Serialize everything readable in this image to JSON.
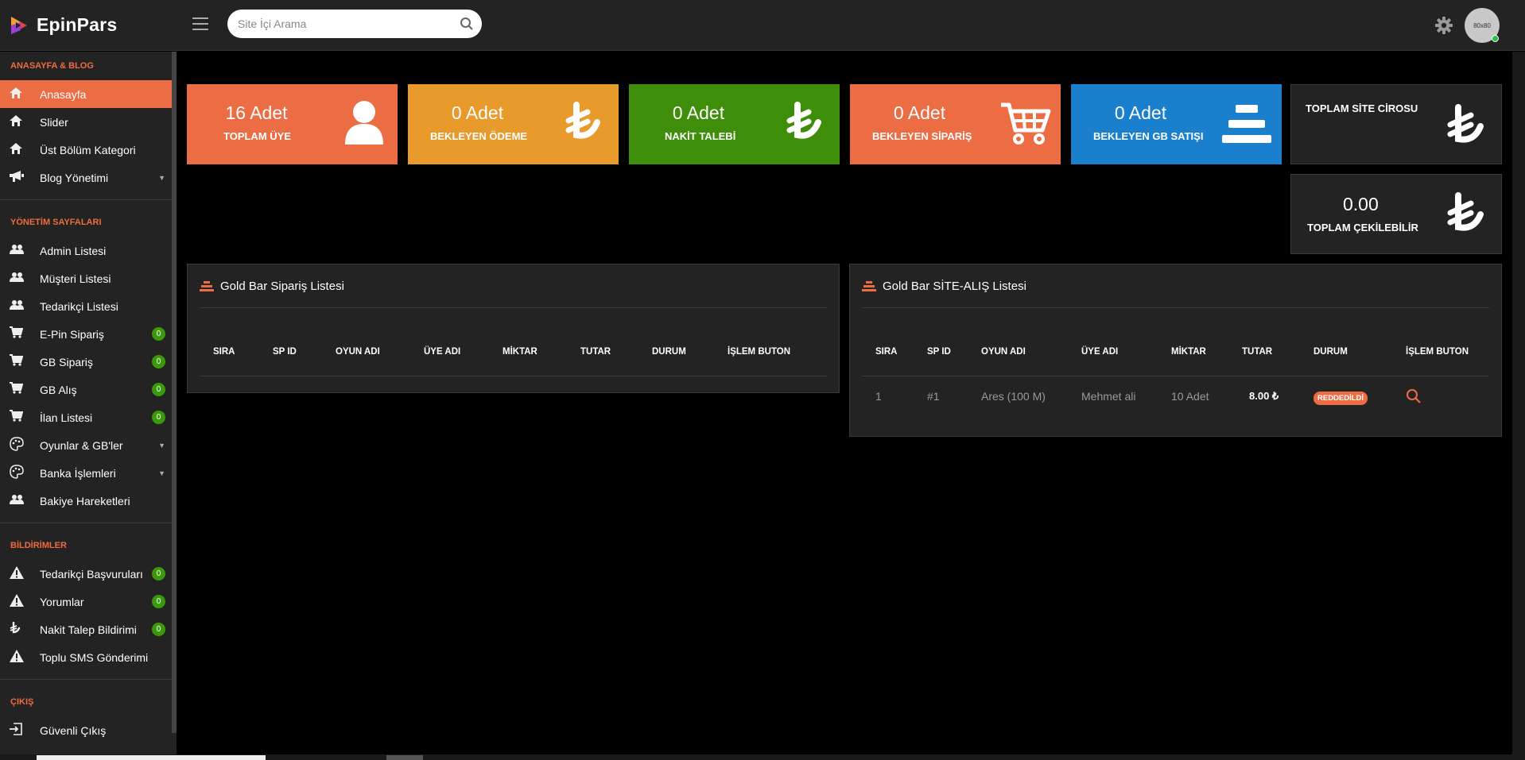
{
  "app": {
    "name": "EpinPars"
  },
  "search": {
    "placeholder": "Site İçi Arama"
  },
  "avatar": {
    "text": "80x80"
  },
  "sidebar": {
    "sections": [
      {
        "title": "ANASAYFA & BLOG",
        "items": [
          {
            "label": "Anasayfa",
            "icon": "home-icon",
            "active": true
          },
          {
            "label": "Slider",
            "icon": "home-icon"
          },
          {
            "label": "Üst Bölüm Kategori",
            "icon": "home-icon"
          },
          {
            "label": "Blog Yönetimi",
            "icon": "megaphone-icon",
            "caret": true
          }
        ]
      },
      {
        "title": "YÖNETİM SAYFALARI",
        "items": [
          {
            "label": "Admin Listesi",
            "icon": "users-icon"
          },
          {
            "label": "Müşteri Listesi",
            "icon": "users-icon"
          },
          {
            "label": "Tedarikçi Listesi",
            "icon": "users-icon"
          },
          {
            "label": "E-Pin Sipariş",
            "icon": "cart-icon",
            "badge": "0"
          },
          {
            "label": "GB Sipariş",
            "icon": "cart-icon",
            "badge": "0"
          },
          {
            "label": "GB Alış",
            "icon": "cart-icon",
            "badge": "0"
          },
          {
            "label": "İlan Listesi",
            "icon": "cart-icon",
            "badge": "0"
          },
          {
            "label": "Oyunlar & GB'ler",
            "icon": "palette-icon",
            "caret": true
          },
          {
            "label": "Banka İşlemleri",
            "icon": "palette-icon",
            "caret": true
          },
          {
            "label": "Bakiye Hareketleri",
            "icon": "users-icon"
          }
        ]
      },
      {
        "title": "BİLDİRİMLER",
        "items": [
          {
            "label": "Tedarikçi Başvuruları",
            "icon": "warning-icon",
            "badge": "0"
          },
          {
            "label": "Yorumlar",
            "icon": "warning-icon",
            "badge": "0"
          },
          {
            "label": "Nakit Talep Bildirimi",
            "icon": "lira-icon",
            "badge": "0"
          },
          {
            "label": "Toplu SMS Gönderimi",
            "icon": "warning-icon"
          }
        ]
      },
      {
        "title": "ÇIKIŞ",
        "items": [
          {
            "label": "Güvenli Çıkış",
            "icon": "logout-icon"
          }
        ]
      }
    ]
  },
  "cards": [
    {
      "number": "16 Adet",
      "label": "TOPLAM ÜYE",
      "color": "#ec6c44",
      "icon": "user-icon"
    },
    {
      "number": "0 Adet",
      "label": "BEKLEYEN ÖDEME",
      "color": "#e89a2b",
      "icon": "lira-icon"
    },
    {
      "number": "0 Adet",
      "label": "NAKİT TALEBİ",
      "color": "#3f8e0a",
      "icon": "lira-icon"
    },
    {
      "number": "0 Adet",
      "label": "BEKLEYEN SİPARİŞ",
      "color": "#ec6c44",
      "icon": "cart-icon"
    },
    {
      "number": "0 Adet",
      "label": "BEKLEYEN GB SATIŞI",
      "color": "#1a7fcd",
      "icon": "gold-bars-icon"
    }
  ],
  "dark_cards": [
    {
      "label": "TOPLAM SİTE CİROSU",
      "icon": "lira-icon"
    },
    {
      "number": "0.00",
      "label": "TOPLAM ÇEKİLEBİLİR",
      "icon": "lira-icon"
    }
  ],
  "panel_left": {
    "title": "Gold Bar Sipariş Listesi",
    "columns": [
      "SIRA",
      "SP ID",
      "OYUN ADI",
      "ÜYE ADI",
      "MİKTAR",
      "TUTAR",
      "DURUM",
      "İŞLEM BUTON"
    ]
  },
  "panel_right": {
    "title": "Gold Bar SİTE-ALIŞ Listesi",
    "columns": [
      "SIRA",
      "SP ID",
      "OYUN ADI",
      "ÜYE ADI",
      "MİKTAR",
      "TUTAR",
      "DURUM",
      "İŞLEM BUTON"
    ],
    "rows": [
      {
        "sira": "1",
        "sp_id": "#1",
        "oyun": "Ares (100 M)",
        "uye": "Mehmet ali",
        "miktar": "10 Adet",
        "tutar": "8.00 ₺",
        "durum": "REDDEDİLDİ"
      }
    ]
  },
  "colors": {
    "accent": "#ec6c44",
    "badge": "#3a9a0c",
    "panel": "#232323"
  }
}
